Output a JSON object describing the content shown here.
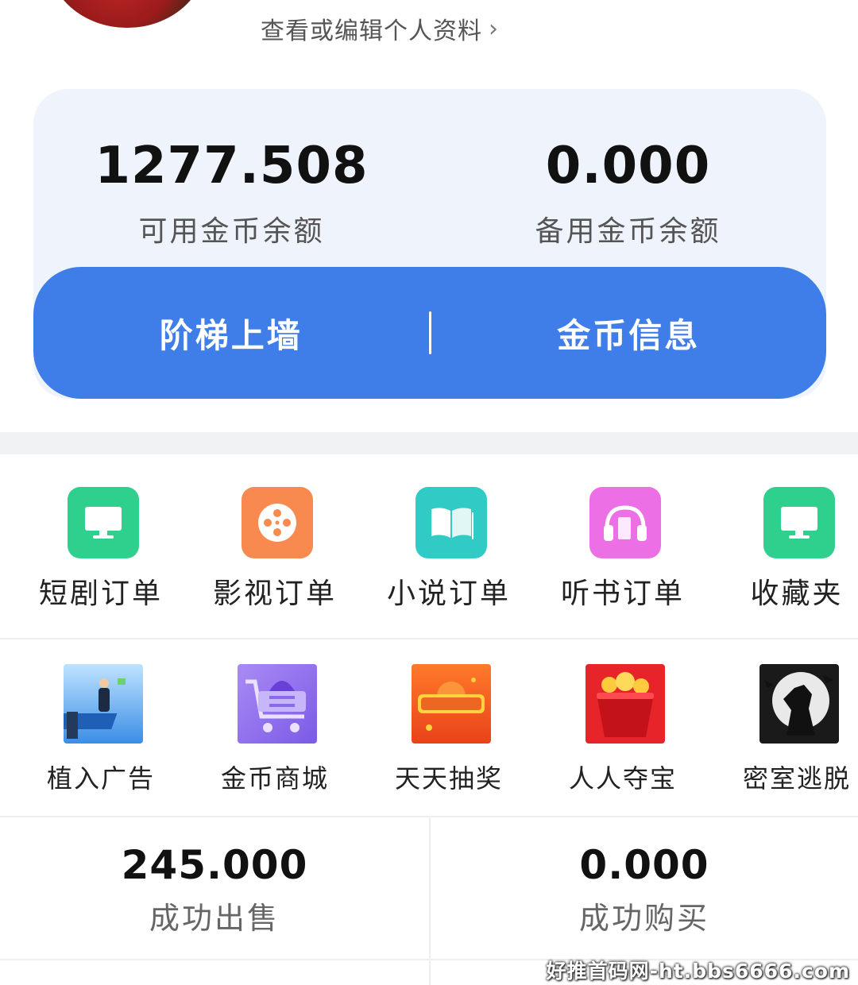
{
  "profile": {
    "link_text": "查看或编辑个人资料",
    "chevron": "›"
  },
  "balances": {
    "available_value": "1277.508",
    "available_label": "可用金币余额",
    "reserve_value": "0.000",
    "reserve_label": "备用金币余额"
  },
  "actions": {
    "ladder_label": "阶梯上墙",
    "coin_info_label": "金币信息"
  },
  "menu_row1": [
    {
      "label": "短剧订单",
      "icon": "monitor-icon",
      "color": "#2fcf8e"
    },
    {
      "label": "影视订单",
      "icon": "film-reel-icon",
      "color": "#f98a4f"
    },
    {
      "label": "小说订单",
      "icon": "book-icon",
      "color": "#30cbc4"
    },
    {
      "label": "听书订单",
      "icon": "headphones-icon",
      "color": "#ec6fe6"
    },
    {
      "label": "收藏夹",
      "icon": "monitor-icon",
      "color": "#2fcf8e"
    }
  ],
  "menu_row2": [
    {
      "label": "植入广告",
      "icon": "ad-placement-icon"
    },
    {
      "label": "金币商城",
      "icon": "shopping-cart-icon"
    },
    {
      "label": "天天抽奖",
      "icon": "lottery-icon"
    },
    {
      "label": "人人夺宝",
      "icon": "treasure-bag-icon"
    },
    {
      "label": "密室逃脱",
      "icon": "escape-room-icon"
    }
  ],
  "stats": {
    "sold_value": "245.000",
    "sold_label": "成功出售",
    "bought_value": "0.000",
    "bought_label": "成功购买"
  },
  "watermark": "好推首码网-ht.bbs6666.com",
  "colors": {
    "accent": "#3f7de8",
    "card_bg": "#eef3fc"
  }
}
